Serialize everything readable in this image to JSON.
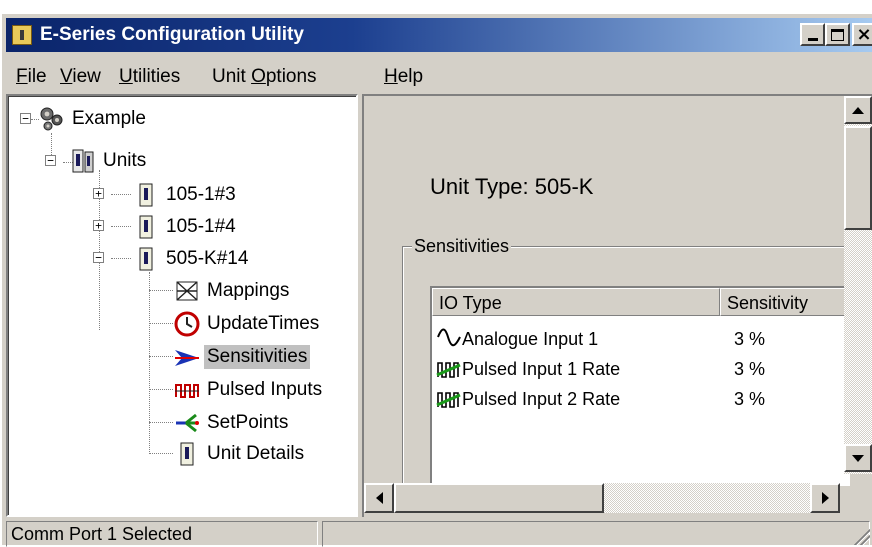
{
  "window": {
    "title": "E-Series Configuration Utility"
  },
  "menubar": {
    "items": [
      {
        "label": "File",
        "mnemonic": "F",
        "rest": "ile"
      },
      {
        "label": "View",
        "mnemonic": "V",
        "rest": "iew"
      },
      {
        "label": "Utilities",
        "mnemonic": "U",
        "rest": "tilities"
      },
      {
        "label": "Unit Options",
        "pre": "Unit ",
        "mnemonic": "O",
        "rest": "ptions"
      },
      {
        "label": "Help",
        "mnemonic": "H",
        "rest": "elp"
      }
    ]
  },
  "tree": {
    "root": {
      "label": "Example",
      "expander": "−"
    },
    "units": {
      "label": "Units",
      "expander": "−"
    },
    "unit_a": {
      "label": "105-1#3",
      "expander": "+"
    },
    "unit_b": {
      "label": "105-1#4",
      "expander": "+"
    },
    "unit_c": {
      "label": "505-K#14",
      "expander": "−"
    },
    "children": [
      {
        "label": "Mappings",
        "icon": "mappings-icon"
      },
      {
        "label": "UpdateTimes",
        "icon": "clock-icon"
      },
      {
        "label": "Sensitivities",
        "icon": "sensitivity-arrow-icon",
        "selected": true
      },
      {
        "label": "Pulsed Inputs",
        "icon": "pulse-icon"
      },
      {
        "label": "SetPoints",
        "icon": "setpoint-icon"
      },
      {
        "label": "Unit Details",
        "icon": "unit-icon"
      }
    ]
  },
  "details": {
    "unit_type": "Unit Type: 505-K",
    "group_label": "Sensitivities",
    "columns": [
      "IO Type",
      "Sensitivity"
    ],
    "rows": [
      {
        "io_type": "Analogue Input 1",
        "sensitivity": "3 %",
        "icon": "analogue-wave-icon"
      },
      {
        "io_type": "Pulsed Input 1 Rate",
        "sensitivity": "3 %",
        "icon": "pulse-rate-icon"
      },
      {
        "io_type": "Pulsed Input 2 Rate",
        "sensitivity": "3 %",
        "icon": "pulse-rate-icon"
      }
    ]
  },
  "statusbar": {
    "left": "Comm Port 1 Selected",
    "right": ""
  }
}
